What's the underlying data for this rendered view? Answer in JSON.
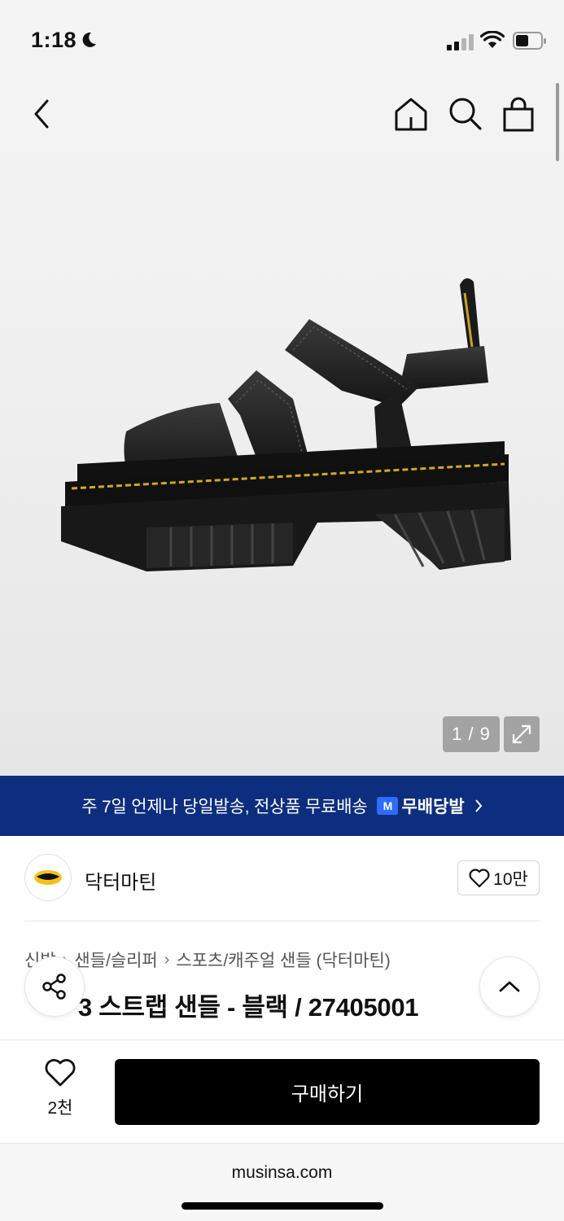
{
  "status_bar": {
    "time": "1:18"
  },
  "gallery": {
    "counter": "1 / 9"
  },
  "promo": {
    "text": "주 7일 언제나 당일발송, 전상품 무료배송",
    "badge_letter": "M",
    "badge_text": "무배당발"
  },
  "brand": {
    "name": "닥터마틴",
    "likes": "10만"
  },
  "breadcrumb": [
    "신발",
    "샌들/슬리퍼",
    "스포츠/캐주얼 샌들 (닥터마틴)"
  ],
  "product": {
    "title": "3 스트랩 샌들 - 블랙 / 27405001"
  },
  "bottom_bar": {
    "wish_count": "2천",
    "buy_label": "구매하기"
  },
  "browser": {
    "url": "musinsa.com"
  },
  "colors": {
    "promo_bg": "#0d2e7e",
    "badge_blue": "#2f6bff",
    "buy_bg": "#000000"
  },
  "icons": [
    "back-icon",
    "home-icon",
    "search-icon",
    "cart-icon",
    "expand-icon",
    "heart-icon",
    "share-icon",
    "chevron-up-icon",
    "chevron-right-icon"
  ]
}
